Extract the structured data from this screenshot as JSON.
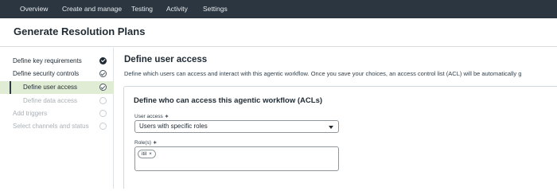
{
  "nav": {
    "items": [
      "Overview",
      "Create and manage",
      "Testing",
      "Activity",
      "Settings"
    ]
  },
  "page": {
    "title": "Generate Resolution Plans"
  },
  "sidebar": {
    "steps": [
      {
        "label": "Define key requirements",
        "status": "done",
        "state": "normal"
      },
      {
        "label": "Define security controls",
        "status": "in-progress",
        "state": "normal"
      },
      {
        "label": "Define user access",
        "status": "in-progress",
        "state": "active"
      },
      {
        "label": "Define data access",
        "status": "not-started",
        "state": "disabled"
      },
      {
        "label": "Add triggers",
        "status": "not-started",
        "state": "disabled"
      },
      {
        "label": "Select channels and status",
        "status": "not-started",
        "state": "disabled"
      }
    ]
  },
  "main": {
    "title": "Define user access",
    "description": "Define which users can access and interact with this agentic workflow. Once you save your choices, an access control list (ACL) will be automatically g"
  },
  "card": {
    "title": "Define who can access this agentic workflow (ACLs)",
    "user_access_label": "User access",
    "user_access_value": "Users with specific roles",
    "roles_label": "Role(s)",
    "required_mark": "∗",
    "roles": [
      "itil"
    ],
    "chip_remove": "×"
  },
  "colors": {
    "nav_bg": "#2c3640",
    "active_step_bg": "#e1ecd5",
    "text": "#1f2a33",
    "disabled_text": "#a9b0b5"
  }
}
